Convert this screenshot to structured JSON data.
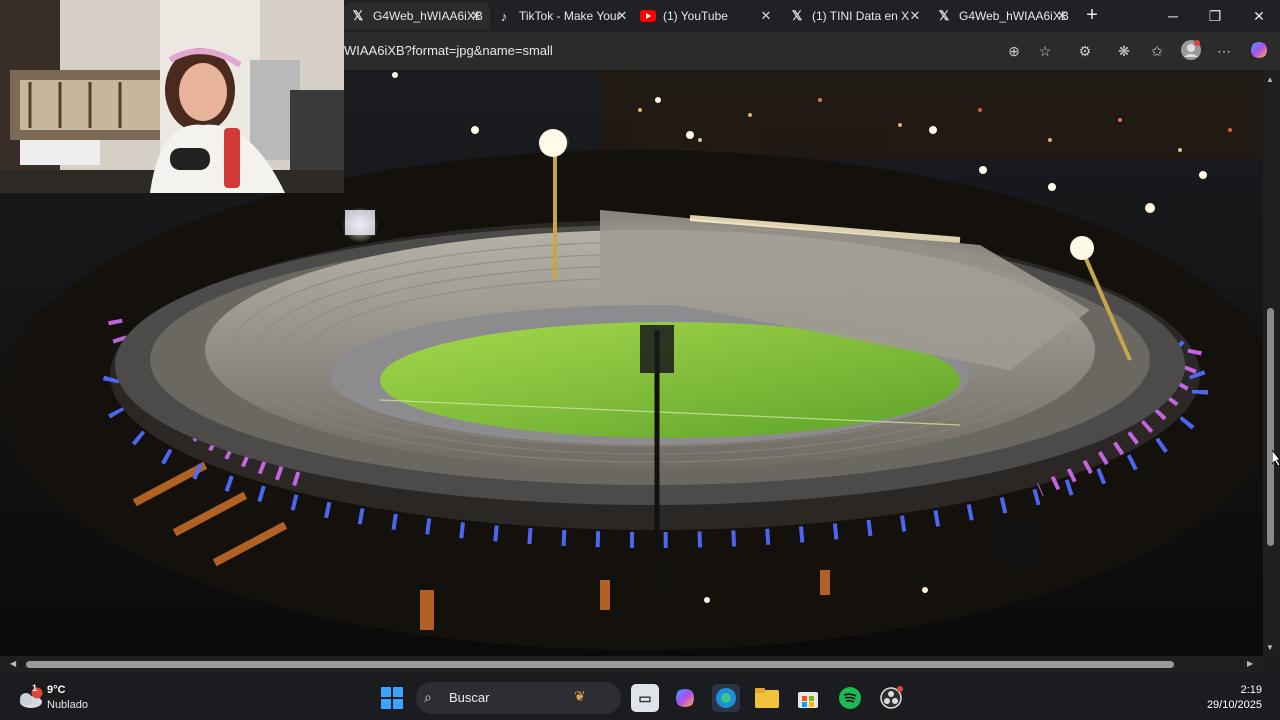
{
  "browser": {
    "tabs": [
      {
        "title": "G4Web_hWIAA6iXB",
        "icon": "x-logo-icon",
        "active": true
      },
      {
        "title": "TikTok - Make Your",
        "icon": "tiktok-icon",
        "active": false
      },
      {
        "title": "(1) YouTube",
        "icon": "youtube-icon",
        "active": false
      },
      {
        "title": "(1) TINI Data en X",
        "icon": "x-logo-icon",
        "active": false
      },
      {
        "title": "G4Web_hWIAA6iXB",
        "icon": "x-logo-icon",
        "active": false
      }
    ],
    "url": "WIAA6iXB?format=jpg&name=small",
    "accent": "#2b2b2b"
  },
  "content": {
    "image": "stadium-night-aerial",
    "colors": {
      "pitch": "#7fbf3a",
      "led_blue": "#5a7dff",
      "led_pink": "#e070ff"
    }
  },
  "taskbar": {
    "weather": {
      "temp": "9°C",
      "desc": "Nublado",
      "badge": "1"
    },
    "search_label": "Buscar",
    "clock": {
      "time": "2:19",
      "date": "29/10/2025"
    }
  }
}
